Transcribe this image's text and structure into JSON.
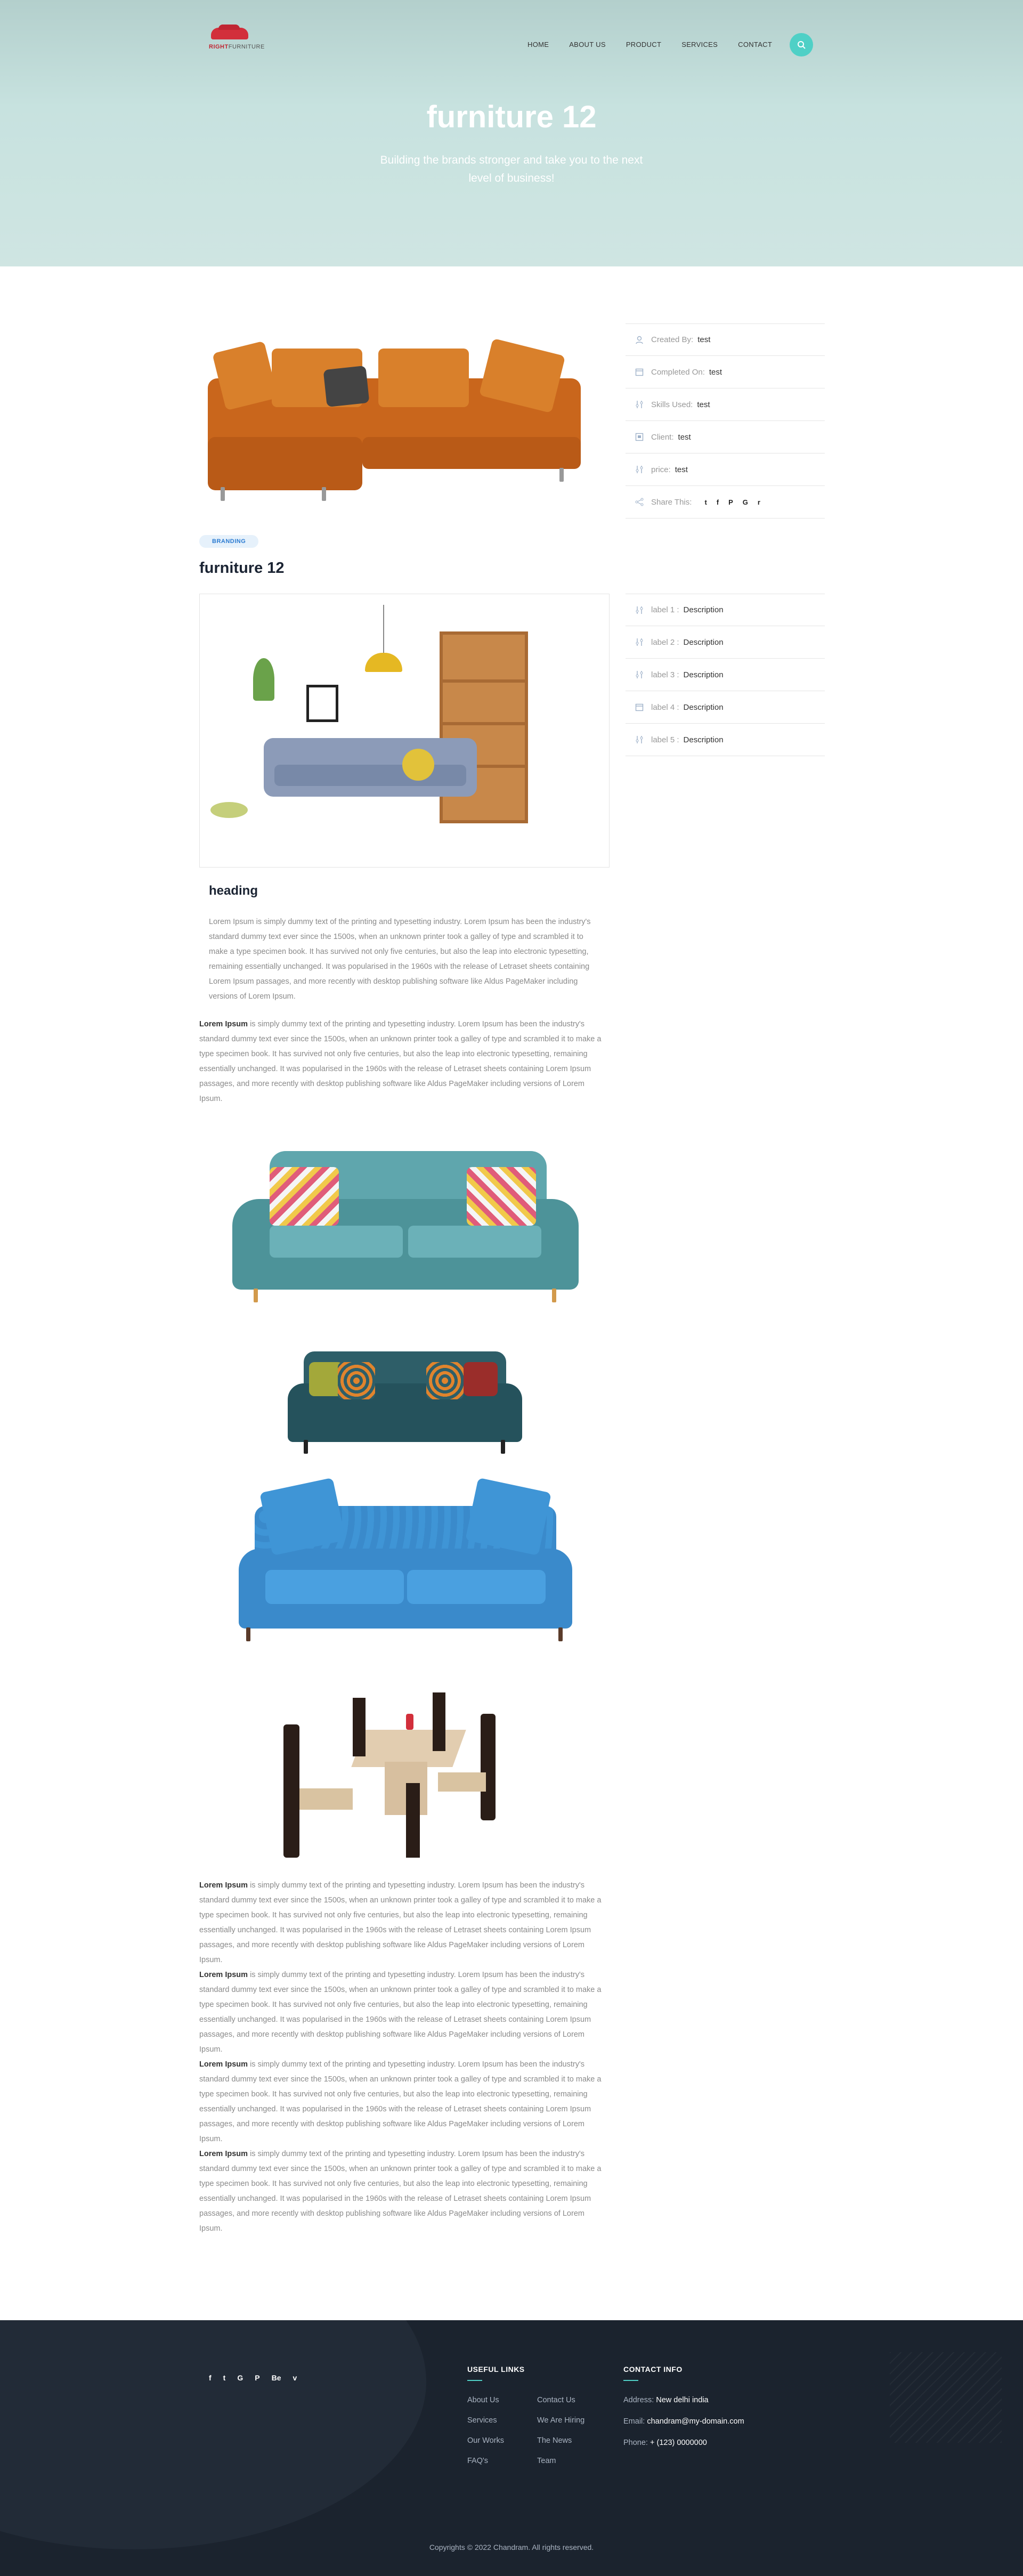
{
  "header": {
    "logo_text_brand": "RIGHT",
    "logo_text_rest": "FURNITURE",
    "nav": [
      "HOME",
      "ABOUT US",
      "PRODUCT",
      "SERVICES",
      "CONTACT"
    ],
    "search_icon": "search-icon"
  },
  "hero": {
    "title": "furniture 12",
    "subtitle": "Building the brands stronger and take you to the next level of business!"
  },
  "post": {
    "tag": "BRANDING",
    "title": "furniture 12",
    "heading": "heading",
    "light_paragraph": "Lorem Ipsum is simply dummy text of the printing and typesetting industry. Lorem Ipsum has been the industry's standard dummy text ever since the 1500s, when an unknown printer took a galley of type and scrambled it to make a type specimen book. It has survived not only five centuries, but also the leap into electronic typesetting, remaining essentially unchanged. It was popularised in the 1960s with the release of Letraset sheets containing Lorem Ipsum passages, and more recently with desktop publishing software like Aldus PageMaker including versions of Lorem Ipsum.",
    "bold_lead": "Lorem Ipsum",
    "body_rest": " is simply dummy text of the printing and typesetting industry. Lorem Ipsum has been the industry's standard dummy text ever since the 1500s, when an unknown printer took a galley of type and scrambled it to make a type specimen book. It has survived not only five centuries, but also the leap into electronic typesetting, remaining essentially unchanged. It was popularised in the 1960s with the release of Letraset sheets containing Lorem Ipsum passages, and more recently with desktop publishing software like Aldus PageMaker including versions of Lorem Ipsum."
  },
  "details": [
    {
      "icon": "user-icon",
      "label": "Created By:",
      "value": "test"
    },
    {
      "icon": "calendar-icon",
      "label": "Completed On:",
      "value": "test"
    },
    {
      "icon": "sliders-icon",
      "label": "Skills Used:",
      "value": "test"
    },
    {
      "icon": "client-icon",
      "label": "Client:",
      "value": "test"
    },
    {
      "icon": "sliders-icon",
      "label": "price:",
      "value": "test"
    }
  ],
  "share": {
    "label": "Share This:",
    "icons": [
      "twitter-icon",
      "facebook-icon",
      "pinterest-icon",
      "google-icon",
      "reddit-icon"
    ],
    "glyphs": [
      "t",
      "f",
      "P",
      "G",
      "r"
    ]
  },
  "extra_details": [
    {
      "icon": "sliders-icon",
      "label": "label 1 :",
      "value": "Description"
    },
    {
      "icon": "sliders-icon",
      "label": "label 2 :",
      "value": "Description"
    },
    {
      "icon": "sliders-icon",
      "label": "label 3 :",
      "value": "Description"
    },
    {
      "icon": "calendar-icon",
      "label": "label 4 :",
      "value": "Description"
    },
    {
      "icon": "sliders-icon",
      "label": "label 5 :",
      "value": "Description"
    }
  ],
  "footer": {
    "social_glyphs": [
      "f",
      "t",
      "G",
      "P",
      "Be",
      "v"
    ],
    "useful_links_title": "USEFUL LINKS",
    "links_col1": [
      "About Us",
      "Services",
      "Our Works",
      "FAQ's"
    ],
    "links_col2": [
      "Contact Us",
      "We Are Hiring",
      "The News",
      "Team"
    ],
    "contact_title": "CONTACT INFO",
    "address_label": "Address:",
    "address": "New delhi india",
    "email_label": "Email:",
    "email": "chandram@my-domain.com",
    "phone_label": "Phone:",
    "phone": "+ (123) 0000000",
    "copyright": "Copyrights © 2022 Chandram. All rights reserved."
  },
  "colors": {
    "accent": "#4fd0c6",
    "footer_bg": "#1b232e",
    "hero_bg": "#c7e2df"
  }
}
